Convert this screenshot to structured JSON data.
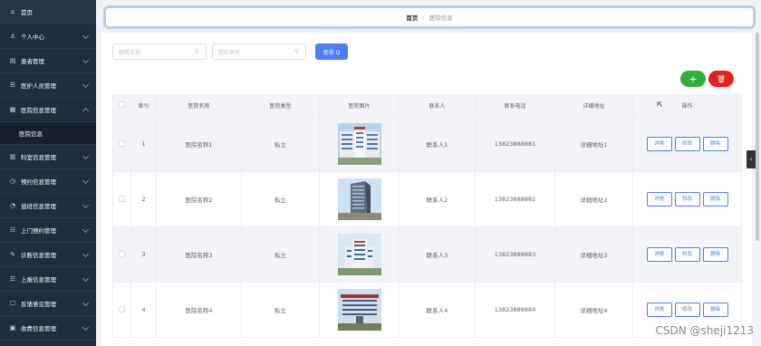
{
  "sidebar": {
    "items": [
      {
        "label": "首页",
        "icon": "home-icon",
        "glyph": "⌂"
      },
      {
        "label": "个人中心",
        "icon": "user-icon",
        "glyph": "♙"
      },
      {
        "label": "患者管理",
        "icon": "patient-icon",
        "glyph": "▤"
      },
      {
        "label": "医护人员管理",
        "icon": "staff-icon",
        "glyph": "☰"
      },
      {
        "label": "医院信息管理",
        "icon": "hospital-icon",
        "glyph": "▦"
      },
      {
        "label": "医院信息",
        "icon": "",
        "glyph": ""
      },
      {
        "label": "科室信息管理",
        "icon": "department-icon",
        "glyph": "▥"
      },
      {
        "label": "预约信息管理",
        "icon": "appointment-icon",
        "glyph": "◷"
      },
      {
        "label": "值班信息管理",
        "icon": "duty-icon",
        "glyph": "◔"
      },
      {
        "label": "上门预约管理",
        "icon": "visit-icon",
        "glyph": "☷"
      },
      {
        "label": "诊断信息管理",
        "icon": "diagnosis-icon",
        "glyph": "✎"
      },
      {
        "label": "上报信息管理",
        "icon": "report-icon",
        "glyph": "☲"
      },
      {
        "label": "反馈意见管理",
        "icon": "feedback-icon",
        "glyph": "☐"
      },
      {
        "label": "收费信息管理",
        "icon": "billing-icon",
        "glyph": "▣"
      }
    ]
  },
  "breadcrumb": {
    "home": "首页",
    "separator": "/",
    "current": "医院信息"
  },
  "search": {
    "name_placeholder": "医院名称",
    "type_placeholder": "医院类型",
    "button_label": "查询 Q"
  },
  "toolbar": {
    "add_label": "+",
    "delete_label": "🗑"
  },
  "table": {
    "headers": [
      "",
      "索引",
      "医院名称",
      "医院类型",
      "医院图片",
      "联系人",
      "联系电话",
      "详细地址",
      "操作"
    ],
    "rows": [
      {
        "index": "1",
        "name": "医院名称1",
        "type": "私立",
        "contact": "联系人1",
        "phone": "13823888881",
        "address": "详细地址1"
      },
      {
        "index": "2",
        "name": "医院名称2",
        "type": "私立",
        "contact": "联系人2",
        "phone": "13823888882",
        "address": "详细地址2"
      },
      {
        "index": "3",
        "name": "医院名称3",
        "type": "私立",
        "contact": "联系人3",
        "phone": "13823888883",
        "address": "详细地址3"
      },
      {
        "index": "4",
        "name": "医院名称4",
        "type": "私立",
        "contact": "联系人4",
        "phone": "13823888884",
        "address": "详细地址4"
      }
    ],
    "actions": {
      "detail": "详情",
      "edit": "修改",
      "delete": "删除"
    }
  },
  "watermark": "CSDN @sheji1213",
  "colors": {
    "sidebar_bg": "#1f2d3d",
    "primary": "#4e7ef7",
    "success": "#2db33a",
    "danger": "#e2231a"
  }
}
